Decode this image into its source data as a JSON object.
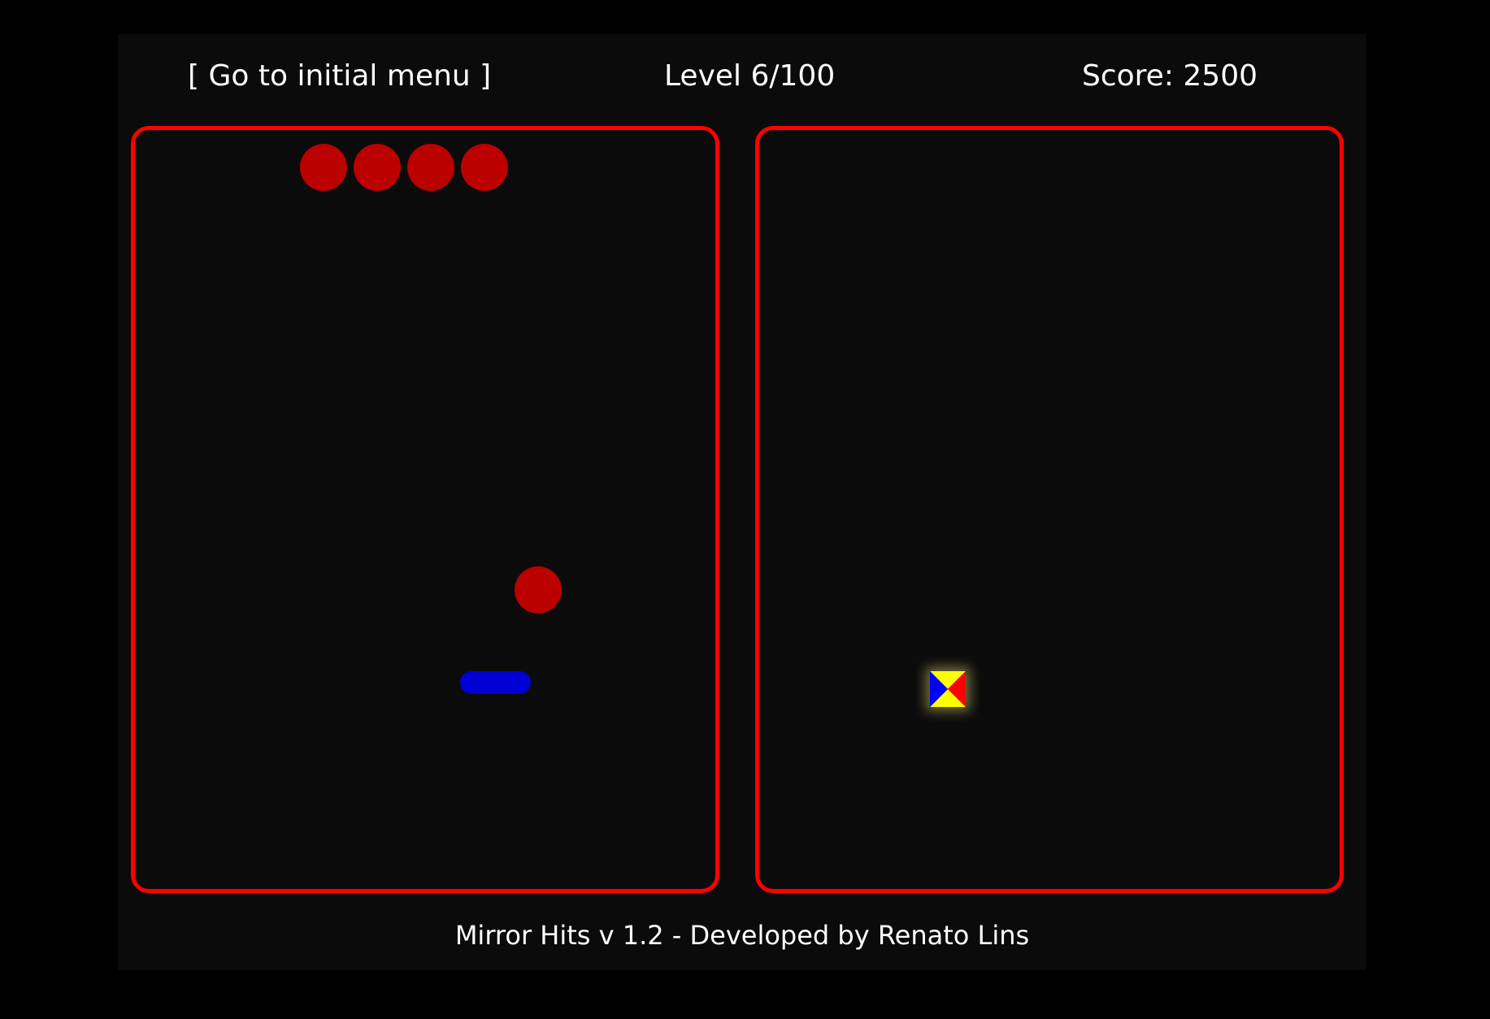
{
  "hud": {
    "menu_link": "[ Go to initial menu ]",
    "level": "Level 6/100",
    "score": "Score: 2500"
  },
  "game": {
    "target_ball_count": 4,
    "active_ball_count": 1,
    "ball_color": "#bb0000",
    "paddle_color": "#0000d4",
    "border_color": "#ff0000",
    "mirror_block_colors": {
      "top": "#ffff00",
      "bottom": "#ffff00",
      "left": "#0000ff",
      "right": "#ff0000"
    }
  },
  "footer": {
    "credit": "Mirror Hits v 1.2 - Developed by Renato Lins"
  }
}
